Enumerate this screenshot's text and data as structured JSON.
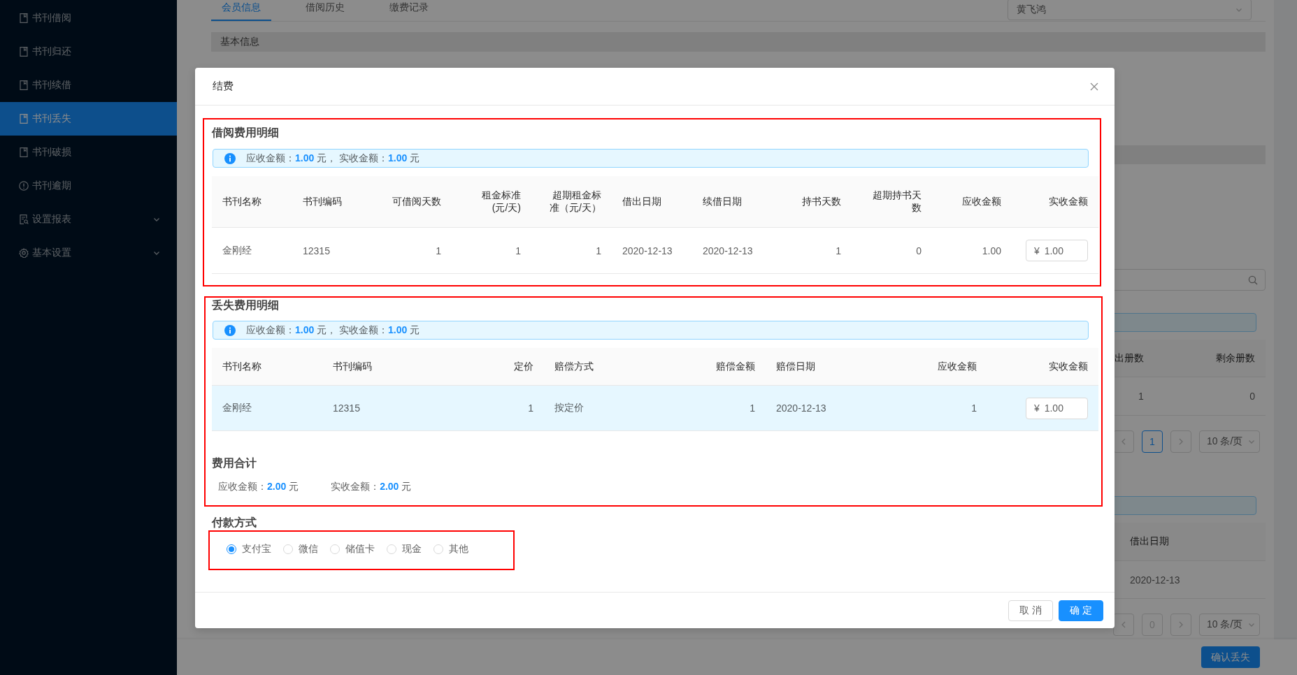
{
  "sidebar": {
    "items": [
      {
        "label": "书刊借阅",
        "kind": "book",
        "selected": false
      },
      {
        "label": "书刊归还",
        "kind": "book",
        "selected": false
      },
      {
        "label": "书刊续借",
        "kind": "book",
        "selected": false
      },
      {
        "label": "书刊丢失",
        "kind": "book",
        "selected": true
      },
      {
        "label": "书刊破损",
        "kind": "book",
        "selected": false
      },
      {
        "label": "书刊逾期",
        "kind": "alert",
        "selected": false
      },
      {
        "label": "设置报表",
        "kind": "report",
        "selected": false
      },
      {
        "label": "基本设置",
        "kind": "settings",
        "selected": false
      }
    ]
  },
  "page": {
    "tabs": [
      {
        "label": "会员信息",
        "selected": true
      },
      {
        "label": "借阅历史",
        "selected": false
      },
      {
        "label": "缴费记录",
        "selected": false
      }
    ],
    "member_select": {
      "value": "黄飞鸿"
    },
    "section_title": "基本信息",
    "stock_table": {
      "columns": [
        "出册数",
        "剩余册数"
      ],
      "rows": [
        [
          "1",
          "0"
        ]
      ]
    },
    "stock_pagination": {
      "pages": [
        {
          "label": "1",
          "selected": true,
          "disabled": false
        }
      ],
      "page_size": "10 条/页"
    },
    "loan_table": {
      "columns": [
        "借出日期"
      ],
      "rows": [
        [
          "2020-12-13"
        ]
      ]
    },
    "loan_pagination": {
      "pages": [
        {
          "label": "0",
          "selected": false,
          "disabled": true
        }
      ],
      "page_size": "10 条/页"
    },
    "confirm_button": "确认丢失"
  },
  "dialog": {
    "title": "结费",
    "borrow": {
      "title": "借阅费用明细",
      "summary": "应收金额：**1.00** 元， 实收金额：**1.00** 元",
      "columns": [
        "书刊名称",
        "书刊编码",
        "可借阅天数",
        "租金标准(元/天)",
        "超期租金标准（元/天）",
        "借出日期",
        "续借日期",
        "持书天数",
        "超期持书天数",
        "应收金额",
        "实收金额"
      ],
      "rows": [
        {
          "cells": [
            "金刚经",
            "12315",
            "1",
            "1",
            "1",
            "2020-12-13",
            "2020-12-13",
            "1",
            "0",
            "1.00"
          ],
          "amount": "¥ 1.00",
          "selected": false
        }
      ]
    },
    "loss": {
      "title": "丢失费用明细",
      "summary": "应收金额：**1.00** 元， 实收金额：**1.00** 元",
      "columns": [
        "书刊名称",
        "书刊编码",
        "定价",
        "赔偿方式",
        "赔偿金额",
        "赔偿日期",
        "应收金额",
        "实收金额"
      ],
      "rows": [
        {
          "cells": [
            "金刚经",
            "12315",
            "1",
            "按定价",
            "1",
            "2020-12-13",
            "1"
          ],
          "amount": "¥ 1.00",
          "selected": true
        }
      ]
    },
    "total": {
      "title": "费用合计",
      "items": [
        "应收金额：**2.00** 元",
        "实收金额：**2.00** 元"
      ]
    },
    "payment": {
      "title": "付款方式",
      "options": [
        {
          "label": "支付宝",
          "selected": true
        },
        {
          "label": "微信",
          "selected": false
        },
        {
          "label": "储值卡",
          "selected": false
        },
        {
          "label": "现金",
          "selected": false
        },
        {
          "label": "其他",
          "selected": false
        }
      ]
    },
    "buttons": [
      {
        "label": "取 消",
        "kind": "default"
      },
      {
        "label": "确 定",
        "kind": "primary"
      }
    ]
  }
}
